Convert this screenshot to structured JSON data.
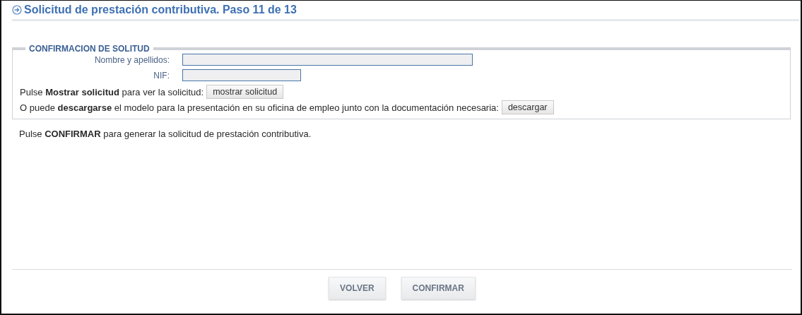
{
  "title": "Solicitud de prestación contributiva. Paso 11 de 13",
  "section": {
    "legend": "CONFIRMACION DE SOLITUD",
    "fields": [
      {
        "label": "Nombre y apellidos:",
        "kind": "wide"
      },
      {
        "label": "NIF:",
        "kind": "narrow"
      }
    ],
    "actions": [
      {
        "text": "Pulse **Mostrar solicitud** para ver la solicitud:",
        "button": "mostrar solicitud"
      },
      {
        "text": "O puede **descargarse** el modelo para la presentación en su oficina de empleo junto con la documentación necesaria:",
        "button": "descargar"
      }
    ]
  },
  "note": "Pulse **CONFIRMAR** para generar la solicitud de prestación contributiva.",
  "buttons": [
    "VOLVER",
    "CONFIRMAR"
  ]
}
